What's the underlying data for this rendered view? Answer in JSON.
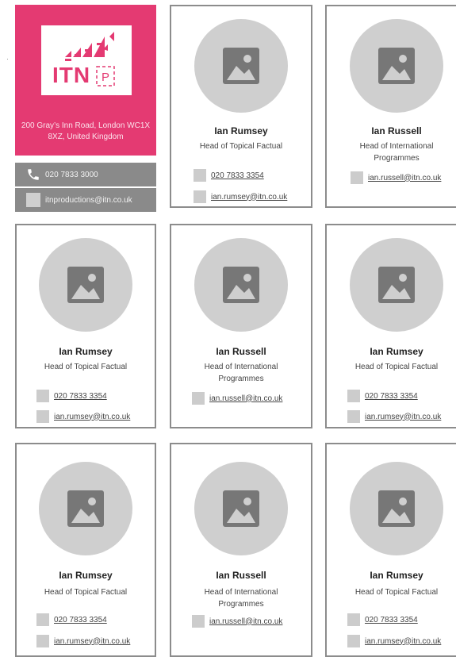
{
  "company": {
    "logo_text": "ITN",
    "logo_badge": "P",
    "address": "200 Gray’s Inn Road, London WC1X 8XZ, United Kingdom",
    "phone": "020 7833 3000",
    "email": "itnproductions@itn.co.uk",
    "colors": {
      "brand": "#e43a72",
      "bar": "#8a8a8a"
    }
  },
  "contacts": [
    {
      "name": "Ian Rumsey",
      "role": "Head of Topical Factual",
      "phone": "020 7833 3354",
      "email": "ian.rumsey@itn.co.uk"
    },
    {
      "name": "Ian Russell",
      "role": "Head of International Programmes",
      "email": "ian.russell@itn.co.uk"
    },
    {
      "name": "Ian Rumsey",
      "role": "Head of Topical Factual",
      "phone": "020 7833 3354",
      "email": "ian.rumsey@itn.co.uk"
    },
    {
      "name": "Ian Russell",
      "role": "Head of International Programmes",
      "email": "ian.russell@itn.co.uk"
    },
    {
      "name": "Ian Rumsey",
      "role": "Head of Topical Factual",
      "phone": "020 7833 3354",
      "email": "ian.rumsey@itn.co.uk"
    },
    {
      "name": "Ian Rumsey",
      "role": "Head of Topical Factual",
      "phone": "020 7833 3354",
      "email": "ian.rumsey@itn.co.uk"
    },
    {
      "name": "Ian Russell",
      "role": "Head of International Programmes",
      "email": "ian.russell@itn.co.uk"
    },
    {
      "name": "Ian Rumsey",
      "role": "Head of Topical Factual",
      "phone": "020 7833 3354",
      "email": "ian.rumsey@itn.co.uk"
    }
  ],
  "icons": {
    "avatar_placeholder": "image-icon",
    "phone": "phone-icon",
    "email": "email-icon"
  }
}
